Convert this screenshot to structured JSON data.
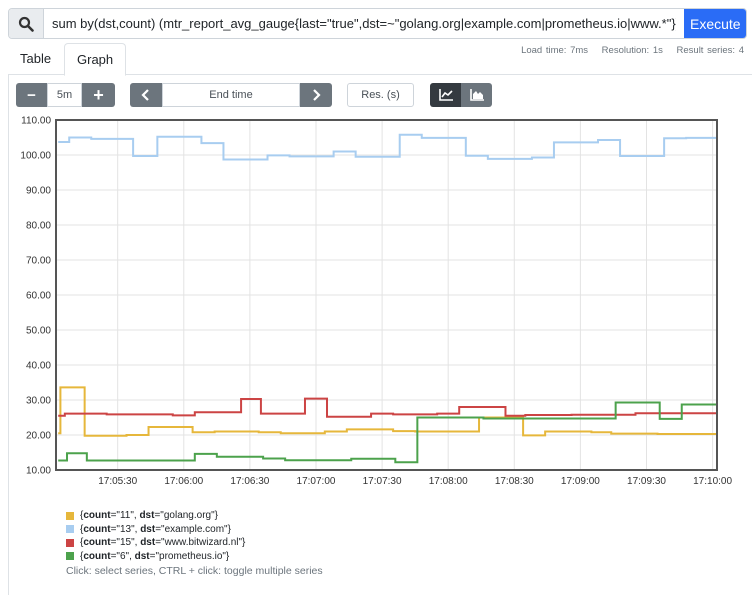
{
  "query": {
    "value": "sum by(dst,count) (mtr_report_avg_gauge{last=\"true\",dst=~\"golang.org|example.com|prometheus.io|www.*\"})",
    "execute_label": "Execute"
  },
  "tabs": [
    {
      "label": "Table",
      "active": false
    },
    {
      "label": "Graph",
      "active": true
    }
  ],
  "stats": {
    "load_time": "Load time: 7ms",
    "resolution": "Resolution: 1s",
    "result_series": "Result series: 4"
  },
  "controls": {
    "range": "5m",
    "minus": "−",
    "plus": "+",
    "end_time_placeholder": "End time",
    "resolution_placeholder": "Res. (s)",
    "chart_modes": [
      "line-chart-icon",
      "stacked-area-icon"
    ],
    "active_mode": "line"
  },
  "chart_data": {
    "type": "line",
    "step": true,
    "xlim": [
      "17:05:02",
      "17:10:02"
    ],
    "ylim": [
      10,
      110
    ],
    "yticks": [
      "10.00",
      "20.00",
      "30.00",
      "40.00",
      "50.00",
      "60.00",
      "70.00",
      "80.00",
      "90.00",
      "100.00",
      "110.00"
    ],
    "xticks": [
      "17:05:30",
      "17:06:00",
      "17:06:30",
      "17:07:00",
      "17:07:30",
      "17:08:00",
      "17:08:30",
      "17:09:00",
      "17:09:30",
      "17:10:00"
    ],
    "grid": true,
    "series": [
      {
        "name": "{count=\"11\", dst=\"golang.org\"}",
        "label_count": "11",
        "label_dst": "golang.org",
        "color": "#e6b73b",
        "points": [
          [
            "17:05:03",
            20.5
          ],
          [
            "17:05:04",
            33.6
          ],
          [
            "17:05:15",
            19.8
          ],
          [
            "17:05:34",
            20.0
          ],
          [
            "17:05:44",
            22.3
          ],
          [
            "17:06:04",
            20.8
          ],
          [
            "17:06:14",
            21.0
          ],
          [
            "17:06:34",
            20.8
          ],
          [
            "17:06:44",
            20.5
          ],
          [
            "17:07:04",
            21.0
          ],
          [
            "17:07:14",
            21.6
          ],
          [
            "17:07:35",
            21.1
          ],
          [
            "17:07:45",
            21.0
          ],
          [
            "17:08:05",
            21.0
          ],
          [
            "17:08:14",
            25.0
          ],
          [
            "17:08:34",
            19.9
          ],
          [
            "17:08:44",
            21.0
          ],
          [
            "17:09:05",
            20.8
          ],
          [
            "17:09:14",
            20.4
          ],
          [
            "17:09:35",
            20.3
          ],
          [
            "17:10:02",
            20.3
          ]
        ]
      },
      {
        "name": "{count=\"13\", dst=\"example.com\"}",
        "label_count": "13",
        "label_dst": "example.com",
        "color": "#a8cdf0",
        "points": [
          [
            "17:05:03",
            103.7
          ],
          [
            "17:05:08",
            105.0
          ],
          [
            "17:05:18",
            104.6
          ],
          [
            "17:05:37",
            99.7
          ],
          [
            "17:05:48",
            105.2
          ],
          [
            "17:06:08",
            103.4
          ],
          [
            "17:06:18",
            98.7
          ],
          [
            "17:06:38",
            99.9
          ],
          [
            "17:06:48",
            99.6
          ],
          [
            "17:07:08",
            101.0
          ],
          [
            "17:07:18",
            99.5
          ],
          [
            "17:07:38",
            105.8
          ],
          [
            "17:07:48",
            104.9
          ],
          [
            "17:08:08",
            99.8
          ],
          [
            "17:08:18",
            98.9
          ],
          [
            "17:08:38",
            99.3
          ],
          [
            "17:08:48",
            103.6
          ],
          [
            "17:09:08",
            104.3
          ],
          [
            "17:09:18",
            99.7
          ],
          [
            "17:09:38",
            104.8
          ],
          [
            "17:09:48",
            104.9
          ],
          [
            "17:10:02",
            104.9
          ]
        ]
      },
      {
        "name": "{count=\"15\", dst=\"www.bitwizard.nl\"}",
        "label_count": "15",
        "label_dst": "www.bitwizard.nl",
        "color": "#cc4444",
        "points": [
          [
            "17:05:03",
            25.5
          ],
          [
            "17:05:06",
            26.1
          ],
          [
            "17:05:25",
            25.9
          ],
          [
            "17:05:55",
            25.6
          ],
          [
            "17:06:05",
            26.5
          ],
          [
            "17:06:26",
            30.3
          ],
          [
            "17:06:35",
            26.1
          ],
          [
            "17:06:55",
            30.4
          ],
          [
            "17:07:05",
            25.2
          ],
          [
            "17:07:25",
            26.1
          ],
          [
            "17:07:35",
            25.9
          ],
          [
            "17:07:55",
            26.1
          ],
          [
            "17:08:05",
            28.0
          ],
          [
            "17:08:26",
            25.5
          ],
          [
            "17:08:35",
            25.7
          ],
          [
            "17:08:56",
            25.8
          ],
          [
            "17:09:25",
            26.2
          ],
          [
            "17:10:02",
            26.2
          ]
        ]
      },
      {
        "name": "{count=\"6\", dst=\"prometheus.io\"}",
        "label_count": "6",
        "label_dst": "prometheus.io",
        "color": "#4ca24c",
        "points": [
          [
            "17:05:03",
            12.7
          ],
          [
            "17:05:07",
            14.8
          ],
          [
            "17:05:16",
            12.7
          ],
          [
            "17:06:05",
            14.6
          ],
          [
            "17:06:15",
            13.8
          ],
          [
            "17:06:36",
            13.3
          ],
          [
            "17:06:46",
            12.8
          ],
          [
            "17:07:16",
            13.2
          ],
          [
            "17:07:36",
            12.2
          ],
          [
            "17:07:46",
            25.0
          ],
          [
            "17:08:16",
            24.7
          ],
          [
            "17:09:16",
            29.3
          ],
          [
            "17:09:36",
            24.6
          ],
          [
            "17:09:46",
            28.7
          ],
          [
            "17:10:02",
            28.7
          ]
        ]
      }
    ]
  },
  "legend": {
    "hint": "Click: select series, CTRL + click: toggle multiple series",
    "count_key": "count",
    "dst_key": "dst"
  }
}
